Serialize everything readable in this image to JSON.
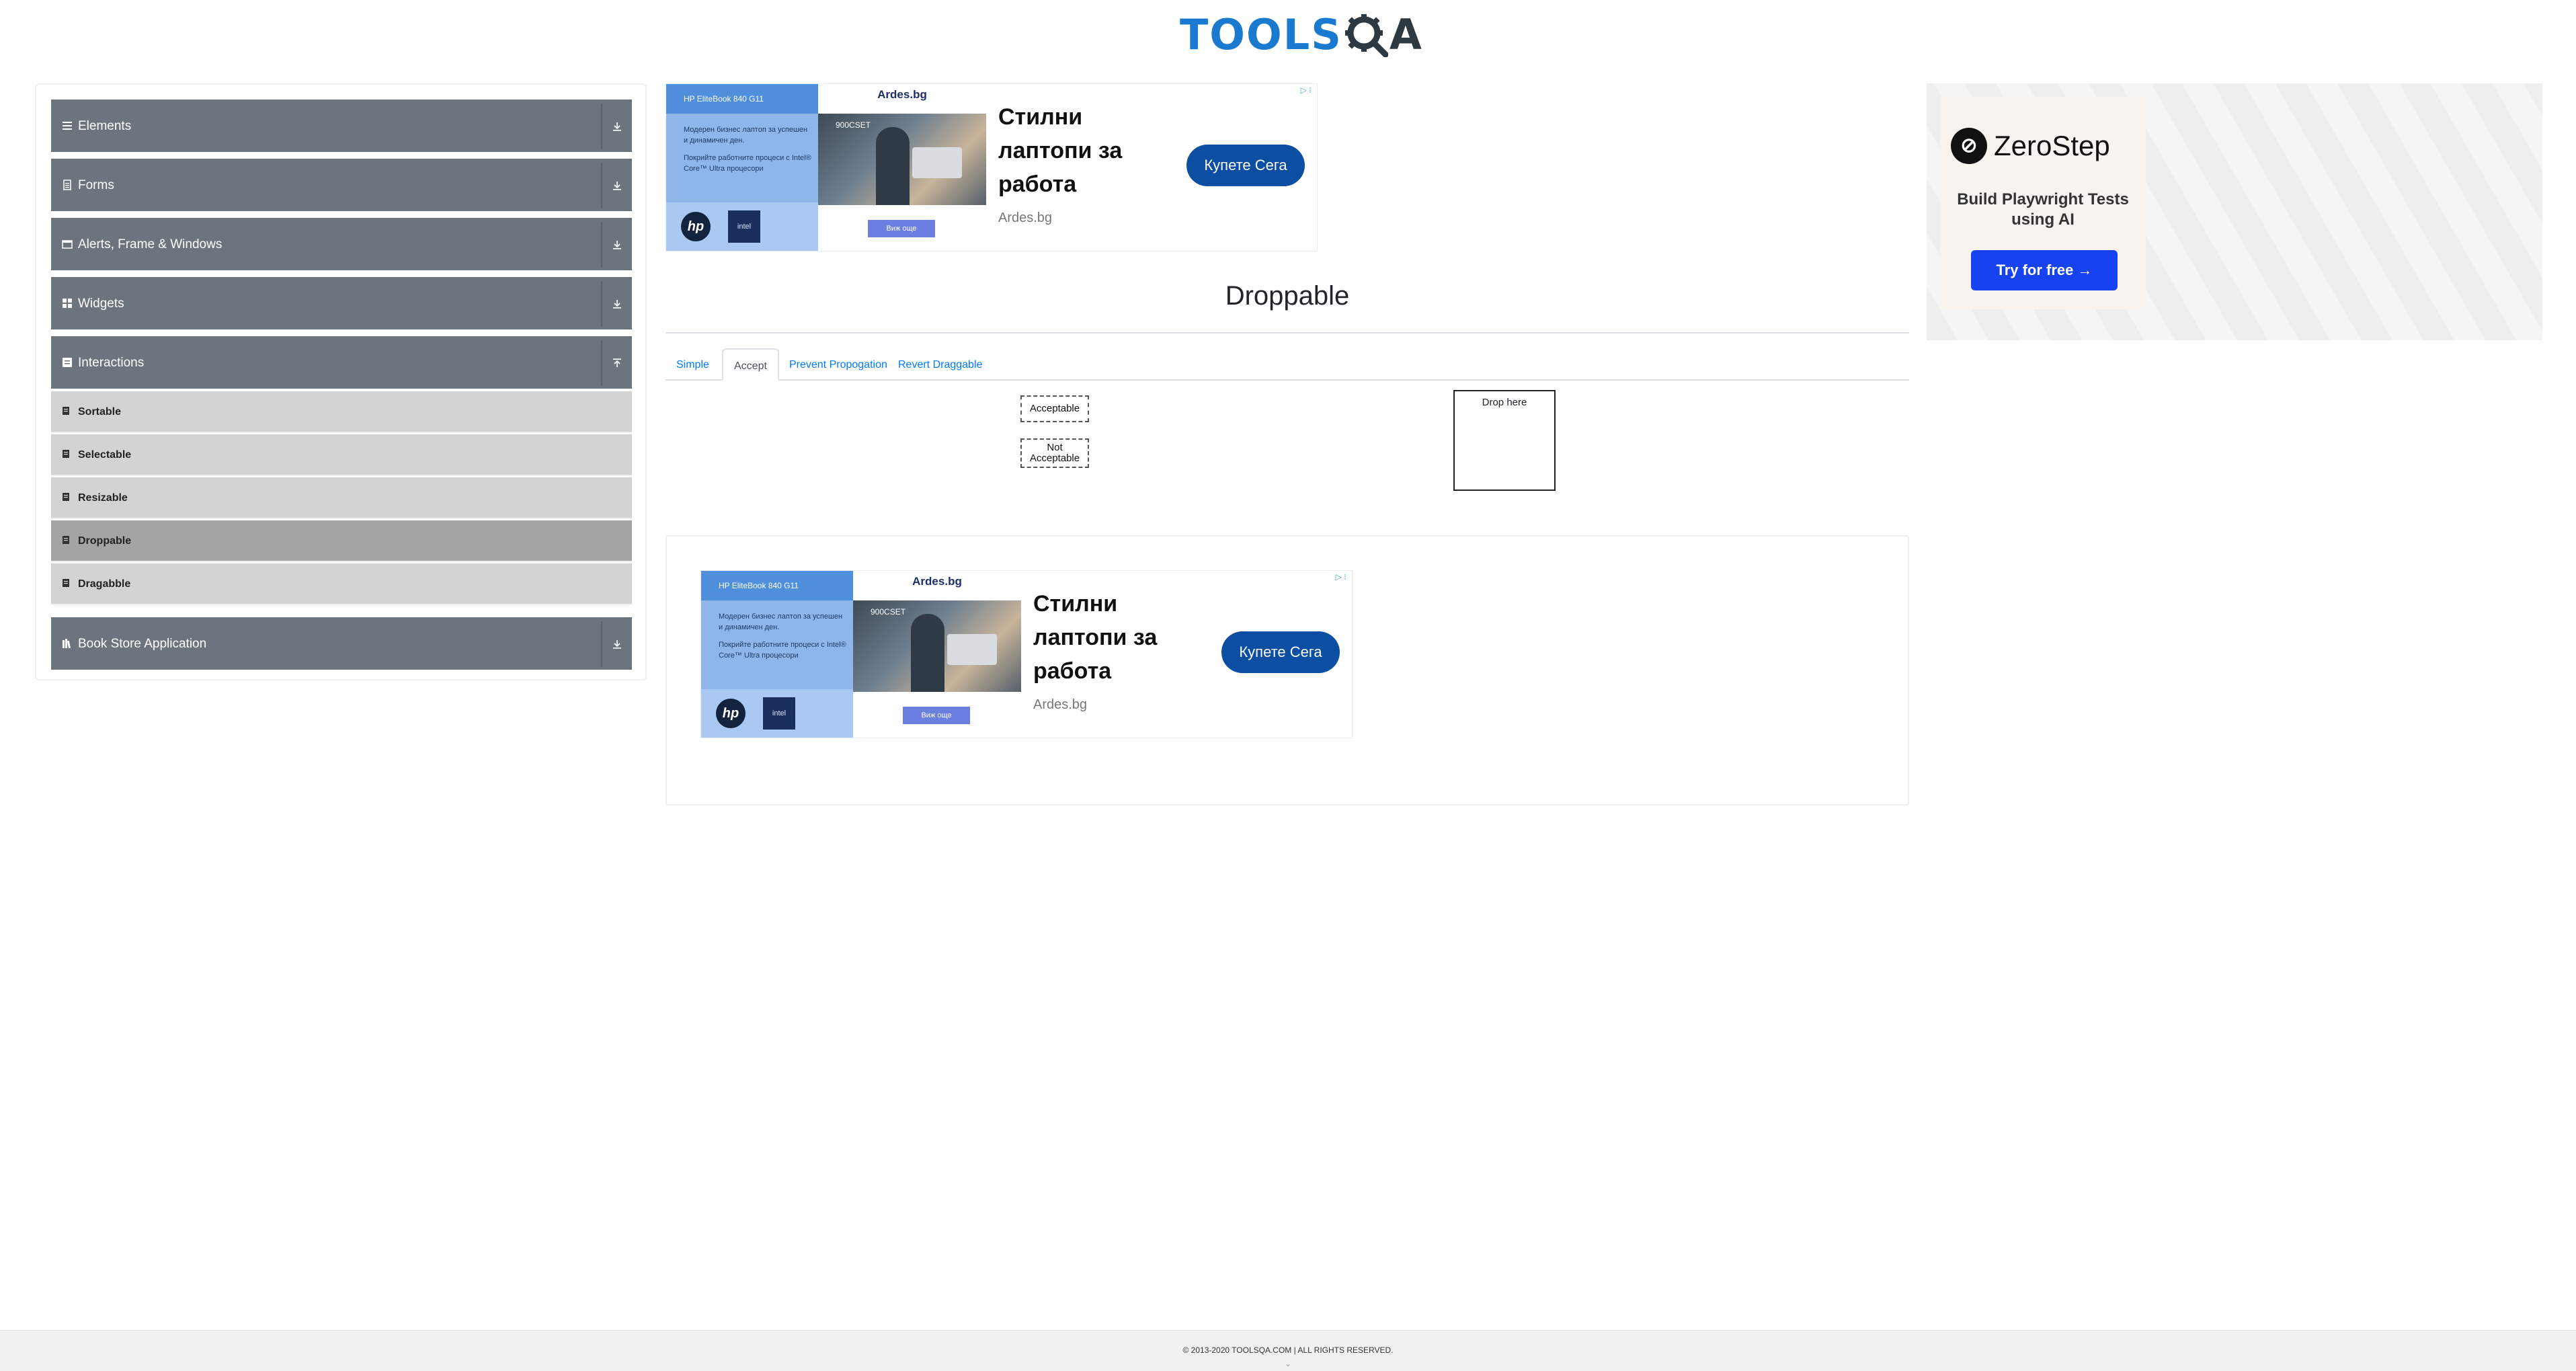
{
  "header": {
    "logo_text": "TOOLS",
    "logo_tail": "A"
  },
  "sidebar": {
    "groups": [
      {
        "label": "Elements",
        "icon": "menu-icon"
      },
      {
        "label": "Forms",
        "icon": "document-icon"
      },
      {
        "label": "Alerts, Frame & Windows",
        "icon": "window-icon"
      },
      {
        "label": "Widgets",
        "icon": "grid-icon"
      },
      {
        "label": "Interactions",
        "icon": "interaction-icon"
      },
      {
        "label": "Book Store Application",
        "icon": "book-icon"
      }
    ],
    "interactions_items": [
      {
        "label": "Sortable"
      },
      {
        "label": "Selectable"
      },
      {
        "label": "Resizable"
      },
      {
        "label": "Droppable",
        "active": true
      },
      {
        "label": "Dragabble"
      }
    ]
  },
  "ads": {
    "top": {
      "model": "HP EliteBook 840 G11",
      "brand": "Ardes.bg",
      "tagline": "Модерен бизнес лаптоп за успешен и динамичен ден.",
      "tagline2": "Покрийте работните процеси с Intel® Core™ Ultra процесори",
      "photo_tag": "900CSET",
      "more_label": "Виж още",
      "headline": "Стилни лаптопи за работа",
      "source": "Ardes.bg",
      "cta": "Купете Сега"
    },
    "right": {
      "name": "ZeroStep",
      "subtitle": "Build Playwright Tests using AI",
      "cta": "Try for free →"
    }
  },
  "main": {
    "title": "Droppable",
    "tabs": [
      {
        "label": "Simple",
        "active": false
      },
      {
        "label": "Accept",
        "active": true
      },
      {
        "label": "Prevent Propogation",
        "active": false
      },
      {
        "label": "Revert Draggable",
        "active": false
      }
    ],
    "acceptable_label": "Acceptable",
    "not_acceptable_label": "Not Acceptable",
    "drop_label": "Drop here"
  },
  "footer": {
    "copyright": "© 2013-2020 TOOLSQA.COM | ALL RIGHTS RESERVED."
  },
  "colors": {
    "sidebar_group": "#6c757d",
    "sidebar_item": "#d3d3d3",
    "sidebar_active": "#a4a4a4",
    "tab_link": "#007bff",
    "brand_blue": "#1a7ad0"
  }
}
